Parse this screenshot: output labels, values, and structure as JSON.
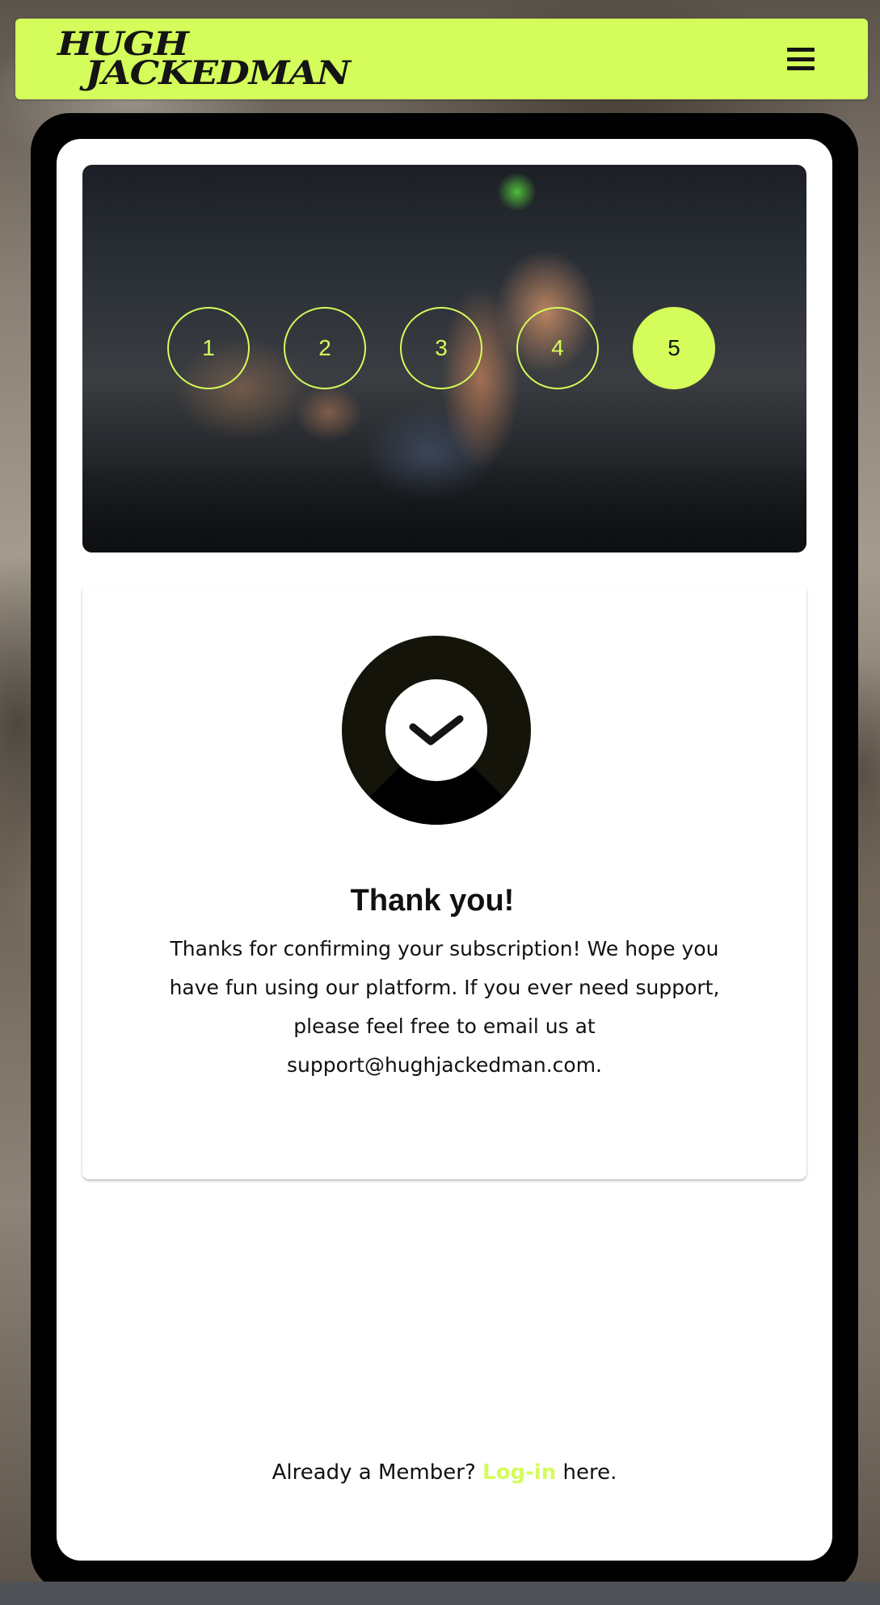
{
  "header": {
    "logo_line1": "HUGH",
    "logo_line2": "JACKEDMAN",
    "menu_icon": "hamburger-icon"
  },
  "steps": [
    {
      "label": "1",
      "active": false
    },
    {
      "label": "2",
      "active": false
    },
    {
      "label": "3",
      "active": false
    },
    {
      "label": "4",
      "active": false
    },
    {
      "label": "5",
      "active": true
    }
  ],
  "confirmation": {
    "icon": "check-icon",
    "title": "Thank you!",
    "body": "Thanks for confirming your subscription! We hope you have fun using our platform. If you ever need support, please feel free to email us at support@hughjackedman.com."
  },
  "footer": {
    "prefix": "Already a Member?",
    "link_label": "Log-in",
    "suffix": "here."
  },
  "colors": {
    "accent": "#d4fc5a",
    "dark": "#141414"
  }
}
